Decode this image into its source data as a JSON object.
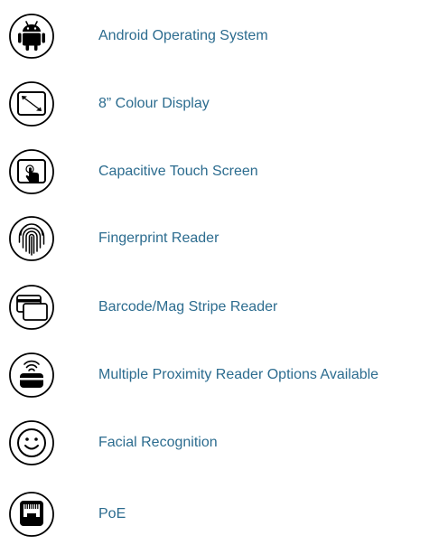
{
  "colors": {
    "label": "#2c6c8f",
    "icon": "#000000",
    "background": "#ffffff"
  },
  "features": [
    {
      "icon": "android-icon",
      "label": "Android Operating System"
    },
    {
      "icon": "resize-display-icon",
      "label": "8” Colour Display"
    },
    {
      "icon": "touch-screen-icon",
      "label": "Capacitive Touch Screen"
    },
    {
      "icon": "fingerprint-icon",
      "label": "Fingerprint Reader"
    },
    {
      "icon": "cards-icon",
      "label": "Barcode/Mag Stripe Reader"
    },
    {
      "icon": "proximity-reader-icon",
      "label": "Multiple Proximity Reader Options Available"
    },
    {
      "icon": "smiley-face-icon",
      "label": "Facial Recognition"
    },
    {
      "icon": "ethernet-port-icon",
      "label": "PoE"
    }
  ]
}
